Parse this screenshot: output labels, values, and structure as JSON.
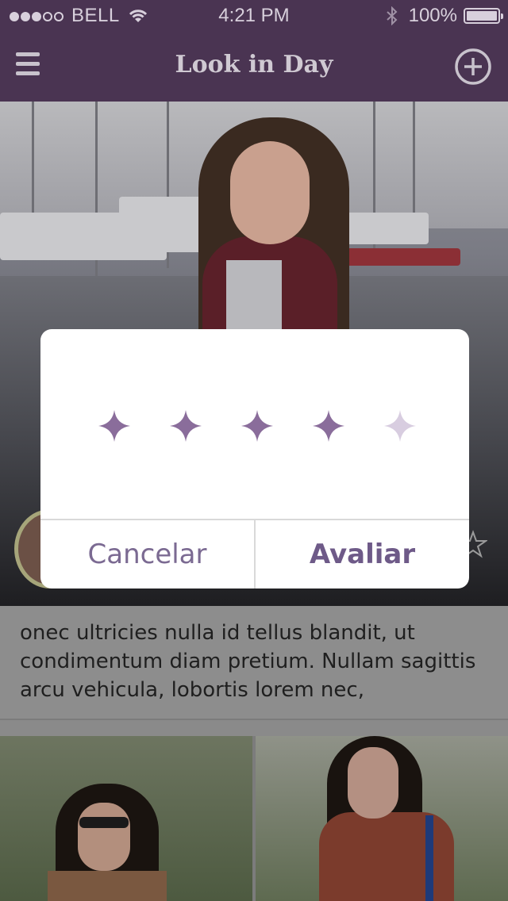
{
  "status_bar": {
    "carrier": "BELL",
    "signal_dots_full": 3,
    "signal_dots_empty": 2,
    "time": "4:21 PM",
    "battery": "100%",
    "icons": [
      "wifi-icon",
      "bluetooth-icon",
      "battery-icon"
    ]
  },
  "nav": {
    "title": "Look in Day",
    "left_icon": "menu-icon",
    "right_icon": "add-circle-icon",
    "background": "#4a3452"
  },
  "post": {
    "description": "onec ultricies nulla id tellus blandit, ut condimentum diam pretium. Nullam sagittis arcu vehicula, lobortis lorem nec,"
  },
  "rating_dialog": {
    "rating": 4,
    "max": 5,
    "star_color_active": "#8a6d9b",
    "star_color_inactive": "#d8cde0",
    "cancel_label": "Cancelar",
    "confirm_label": "Avaliar"
  }
}
